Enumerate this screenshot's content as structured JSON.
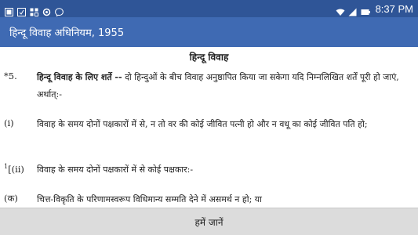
{
  "status_bar": {
    "time": "8:37 PM",
    "left_icons": [
      "notification-icon",
      "square-notification-icon",
      "gallery-icon",
      "settings-icon",
      "messenger-icon"
    ],
    "right_icons": [
      "wifi-icon",
      "signal-icon",
      "battery-icon"
    ]
  },
  "app_bar": {
    "title": "हिन्दू विवाह अधिनियम, 1955"
  },
  "content": {
    "section_title": "हिन्दू विवाह",
    "paragraphs": [
      {
        "marker": "*5.",
        "heading": "हिन्दू विवाह के लिए शर्ते --",
        "text": " दो हिन्दुओं के बीच विवाह अनुष्ठापित किया जा सकेगा यदि निम्नलिखित शर्तें पूरी हो जाएं, अर्थात्:-"
      },
      {
        "marker": "(i)",
        "text": "विवाह के समय दोनों पक्षकारों में से, न तो वर की कोई जीवित पत्नी हो और न वधू का कोई जीवित पति हो;"
      },
      {
        "marker_sup": "1",
        "marker": "[(ii)",
        "text": "विवाह के समय दोनों पक्षकारों में से कोई पक्षकार:-"
      },
      {
        "marker": "(क)",
        "text": "चित्त-विकृति के परिणामस्वरूप विधिमान्य सम्मति देने में असमर्थ न हो; या"
      }
    ]
  },
  "bottom_button": {
    "label": "हमें जानें"
  }
}
